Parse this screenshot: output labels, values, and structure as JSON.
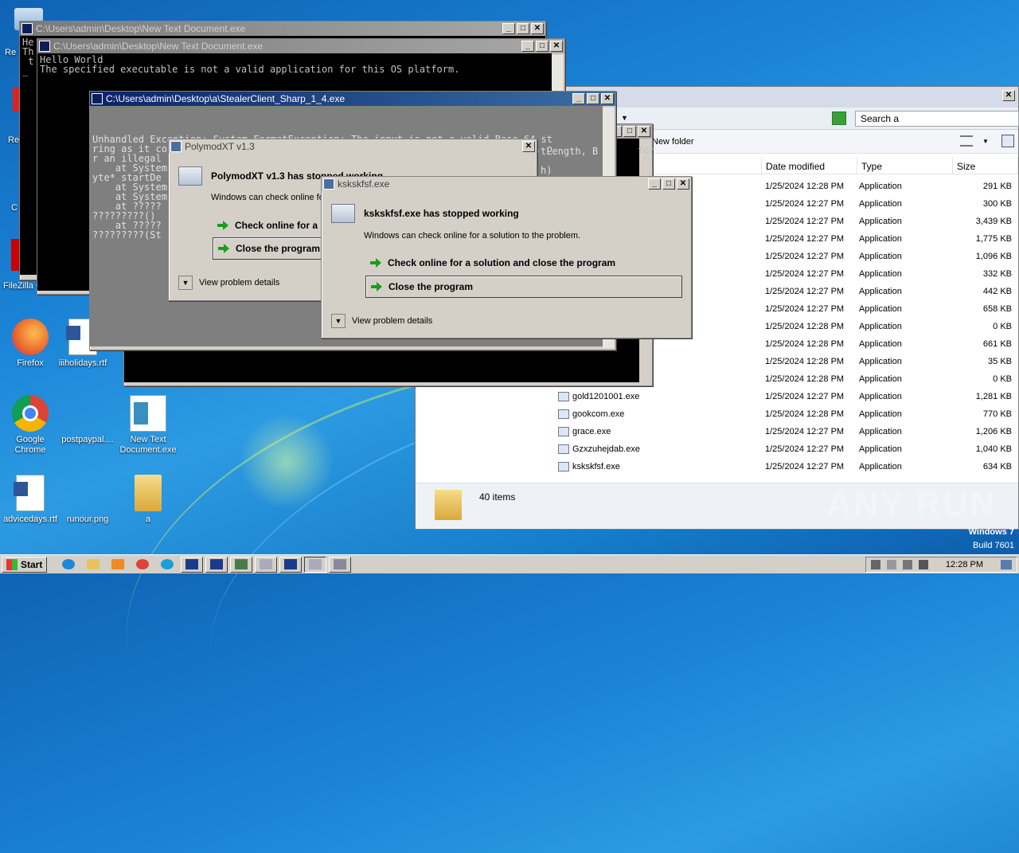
{
  "desktop": {
    "icons": [
      {
        "name": "Firefox",
        "color": "#e8652b"
      },
      {
        "name": "iiiholidays.rtf",
        "color": "#2b579a"
      },
      {
        "name": "Google Chrome",
        "color": "#db4437"
      },
      {
        "name": "postpaypal....",
        "color": "#1d82d6"
      },
      {
        "name": "New Text Document.exe",
        "color": "#cfd8e6"
      },
      {
        "name": "advicedays.rtf",
        "color": "#2b579a"
      },
      {
        "name": "runour.png",
        "color": "#1d82d6"
      },
      {
        "name": "a",
        "color": "#e8c35b"
      }
    ],
    "partial_labels": [
      "Re",
      "Re",
      "C",
      "FileZilla C"
    ],
    "watermark": "ANY RUN",
    "windows_edition": "Windows 7",
    "build": "Build 7601"
  },
  "console1": {
    "title": "C:\\Users\\admin\\Desktop\\New Text Document.exe",
    "left_fragment": "He\nTh\n t\n_"
  },
  "console2": {
    "title": "C:\\Users\\admin\\Desktop\\New Text Document.exe",
    "lines": "Hello World\nThe specified executable is not a valid application for this OS platform."
  },
  "console3": {
    "title": "C:\\Users\\admin\\Desktop\\a\\StealerClient_Sharp_1_4.exe",
    "lines": "Unhandled Exception: System.FormatException: The input is not a valid Base-64 st\nring as it contains a non-base 64 character, more than two padding characters, o\nr an illegal\n    at System\nyte* startDe\n    at System\n    at System\n    at ?????\n?????????()\n    at ?????\n?????????(St",
    "right_fragment_1": "tLength, B",
    "right_fragment_2": "h)"
  },
  "dialog_polymod": {
    "title": "PolymodXT v1.3",
    "heading": "PolymodXT v1.3 has stopped working",
    "message": "Windows can check online fo",
    "option_check": "Check online for a s",
    "option_close": "Close the program",
    "details": "View problem details"
  },
  "dialog_kskskfsf": {
    "title": "kskskfsf.exe",
    "heading": "kskskfsf.exe has stopped working",
    "message": "Windows can check online for a solution to the problem.",
    "option_check": "Check online for a solution and close the program",
    "option_close": "Close the program",
    "details": "View problem details"
  },
  "explorer": {
    "search_placeholder": "Search a",
    "new_folder": "New folder",
    "behind_text": "for",
    "columns": [
      "Date modified",
      "Type",
      "Size"
    ],
    "rows": [
      {
        "name": "",
        "date": "1/25/2024 12:28 PM",
        "type": "Application",
        "size": "291 KB"
      },
      {
        "name": "",
        "date": "1/25/2024 12:27 PM",
        "type": "Application",
        "size": "300 KB"
      },
      {
        "name": "",
        "date": "1/25/2024 12:27 PM",
        "type": "Application",
        "size": "3,439 KB"
      },
      {
        "name": "",
        "date": "1/25/2024 12:27 PM",
        "type": "Application",
        "size": "1,775 KB"
      },
      {
        "name": "",
        "date": "1/25/2024 12:27 PM",
        "type": "Application",
        "size": "1,096 KB"
      },
      {
        "name": "",
        "date": "1/25/2024 12:27 PM",
        "type": "Application",
        "size": "332 KB"
      },
      {
        "name": "",
        "date": "1/25/2024 12:27 PM",
        "type": "Application",
        "size": "442 KB"
      },
      {
        "name": "",
        "date": "1/25/2024 12:27 PM",
        "type": "Application",
        "size": "658 KB"
      },
      {
        "name": "",
        "date": "1/25/2024 12:28 PM",
        "type": "Application",
        "size": "0 KB"
      },
      {
        "name": "",
        "date": "1/25/2024 12:28 PM",
        "type": "Application",
        "size": "661 KB"
      },
      {
        "name": "",
        "date": "1/25/2024 12:28 PM",
        "type": "Application",
        "size": "35 KB"
      },
      {
        "name": "",
        "date": "1/25/2024 12:28 PM",
        "type": "Application",
        "size": "0 KB"
      },
      {
        "name": "gold1201001.exe",
        "date": "1/25/2024 12:27 PM",
        "type": "Application",
        "size": "1,281 KB"
      },
      {
        "name": "gookcom.exe",
        "date": "1/25/2024 12:28 PM",
        "type": "Application",
        "size": "770 KB"
      },
      {
        "name": "grace.exe",
        "date": "1/25/2024 12:27 PM",
        "type": "Application",
        "size": "1,206 KB"
      },
      {
        "name": "Gzxzuhejdab.exe",
        "date": "1/25/2024 12:27 PM",
        "type": "Application",
        "size": "1,040 KB"
      },
      {
        "name": "kskskfsf.exe",
        "date": "1/25/2024 12:27 PM",
        "type": "Application",
        "size": "634 KB"
      }
    ],
    "status": "40 items"
  },
  "taskbar": {
    "start": "Start",
    "clock": "12:28 PM"
  }
}
